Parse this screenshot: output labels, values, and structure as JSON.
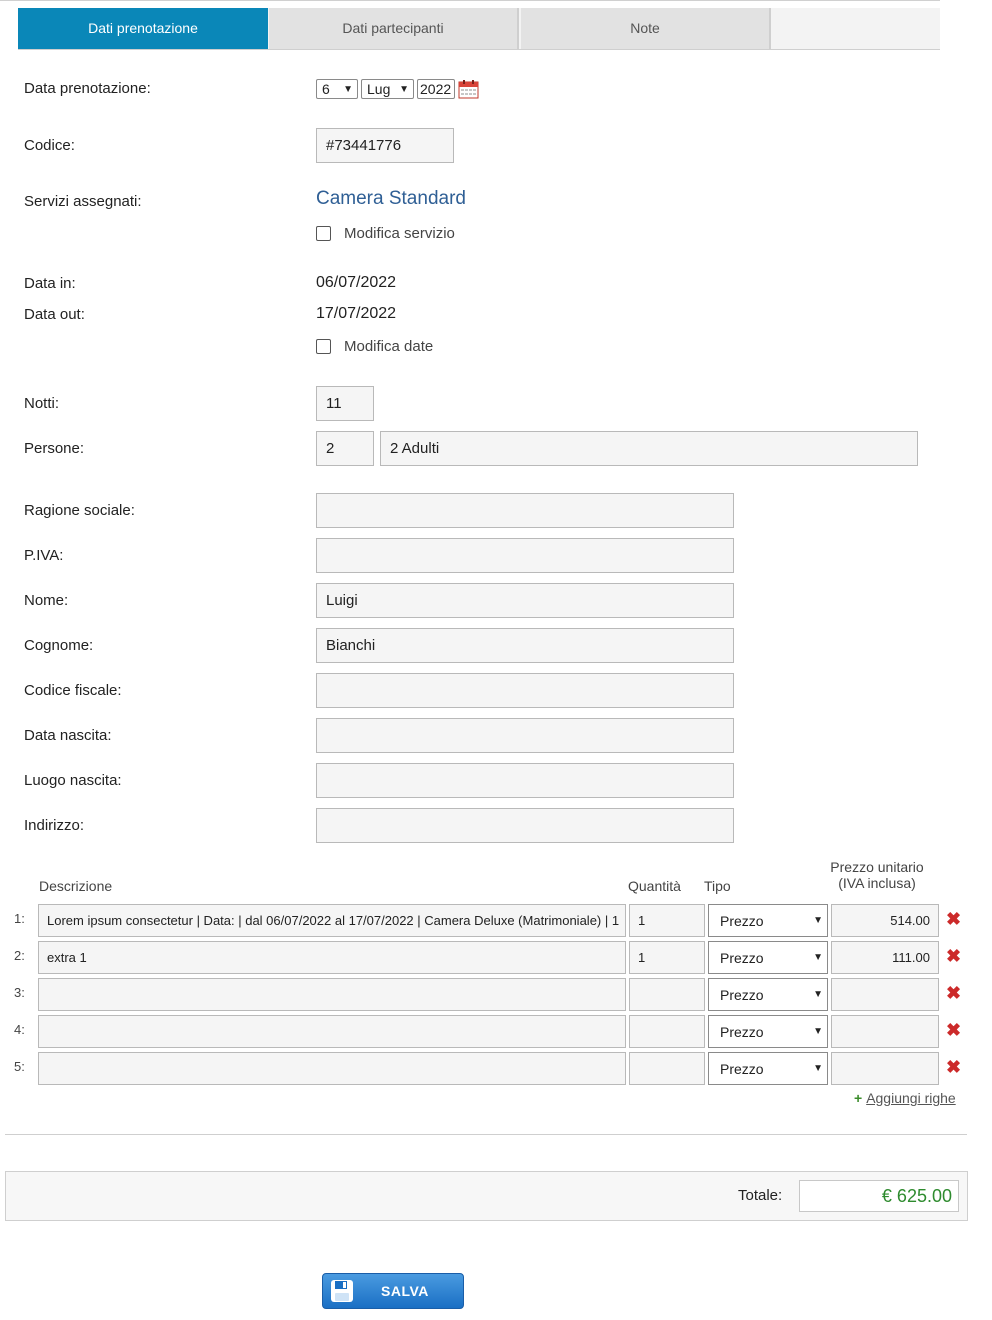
{
  "tabs": [
    "Dati prenotazione",
    "Dati partecipanti",
    "Note"
  ],
  "booking_date": {
    "label": "Data prenotazione:",
    "day": "6",
    "month": "Lug",
    "year": "2022"
  },
  "code": {
    "label": "Codice:",
    "value": "#73441776"
  },
  "services": {
    "label": "Servizi assegnati:",
    "value": "Camera Standard",
    "modify_label": "Modifica servizio"
  },
  "dates": {
    "in_label": "Data in:",
    "in_value": "06/07/2022",
    "out_label": "Data out:",
    "out_value": "17/07/2022",
    "modify_label": "Modifica date"
  },
  "nights": {
    "label": "Notti:",
    "value": "11"
  },
  "people": {
    "label": "Persone:",
    "count": "2",
    "desc": "2 Adulti"
  },
  "customer": [
    {
      "label": "Ragione sociale:",
      "value": ""
    },
    {
      "label": "P.IVA:",
      "value": ""
    },
    {
      "label": "Nome:",
      "value": "Luigi"
    },
    {
      "label": "Cognome:",
      "value": "Bianchi"
    },
    {
      "label": "Codice fiscale:",
      "value": ""
    },
    {
      "label": "Data nascita:",
      "value": ""
    },
    {
      "label": "Luogo nascita:",
      "value": ""
    },
    {
      "label": "Indirizzo:",
      "value": ""
    }
  ],
  "items_table": {
    "headers": {
      "desc": "Descrizione",
      "qty": "Quantità",
      "type": "Tipo",
      "price_line1": "Prezzo unitario",
      "price_line2": "(IVA inclusa)"
    },
    "rows": [
      {
        "num": "1:",
        "desc": "Lorem ipsum consectetur | Data: | dal 06/07/2022 al 17/07/2022 | Camera Deluxe (Matrimoniale) | 1",
        "qty": "1",
        "type": "Prezzo",
        "price": "514.00"
      },
      {
        "num": "2:",
        "desc": "extra 1",
        "qty": "1",
        "type": "Prezzo",
        "price": "111.00"
      },
      {
        "num": "3:",
        "desc": "",
        "qty": "",
        "type": "Prezzo",
        "price": ""
      },
      {
        "num": "4:",
        "desc": "",
        "qty": "",
        "type": "Prezzo",
        "price": ""
      },
      {
        "num": "5:",
        "desc": "",
        "qty": "",
        "type": "Prezzo",
        "price": ""
      }
    ],
    "add_rows_label": "Aggiungi righe"
  },
  "total": {
    "label": "Totale:",
    "value": "€ 625.00"
  },
  "save_label": "SALVA",
  "colors": {
    "tab_active": "#0a87b8",
    "service": "#2f5f95",
    "total": "#2e8b2e",
    "delete": "#cc2a2a"
  }
}
